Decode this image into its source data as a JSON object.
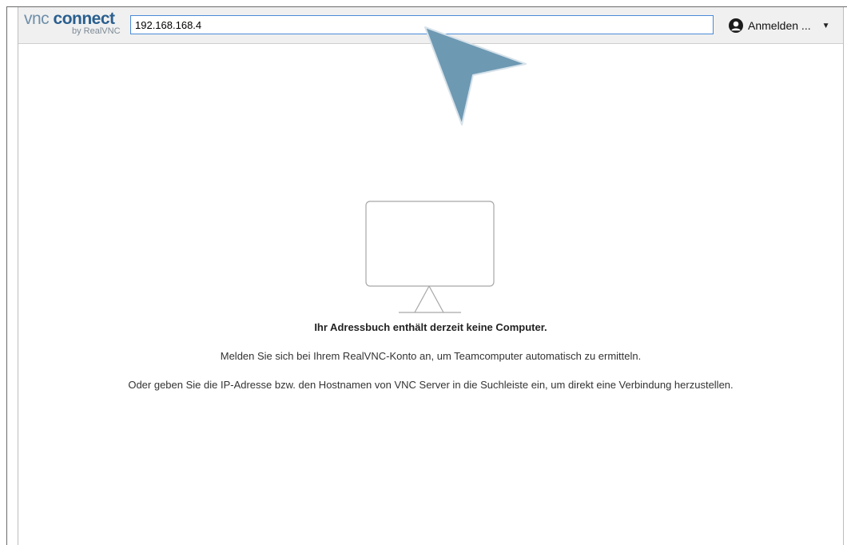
{
  "toolbar": {
    "logo": {
      "vnc": "vnc ",
      "connect": "connect",
      "by": "by RealVNC"
    },
    "search": {
      "value": "192.168.168.4",
      "icon": "search-field"
    },
    "signin": {
      "label": "Anmelden ...",
      "icon": "user-icon",
      "caret_icon": "chevron-down-icon"
    }
  },
  "empty_state": {
    "icon": "monitor-icon",
    "title": "Ihr Adressbuch enthält derzeit keine Computer.",
    "line1": "Melden Sie sich bei Ihrem RealVNC-Konto an, um Teamcomputer automatisch zu ermitteln.",
    "line2": "Oder geben Sie die IP-Adresse bzw. den Hostnamen von VNC Server in die Suchleiste ein, um direkt eine Verbindung herzustellen."
  },
  "colors": {
    "accent": "#4a8ad6",
    "brand": "#2a5f8f",
    "cursor": "#6e99b3"
  }
}
